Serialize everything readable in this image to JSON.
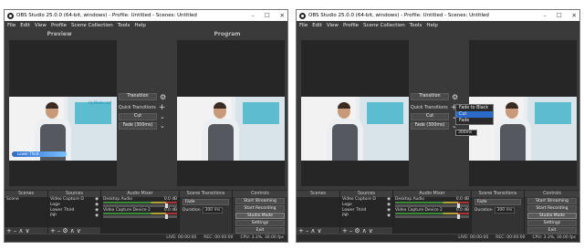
{
  "window_title": "OBS Studio 25.0.0 (64-bit, windows) - Profile: Untitled - Scenes: Untitled",
  "window_controls": [
    "–",
    "☐",
    "✕"
  ],
  "menu": [
    "File",
    "Edit",
    "View",
    "Profile",
    "Scene Collection",
    "Tools",
    "Help"
  ],
  "preview_label": "Preview",
  "program_label": "Program",
  "overlay": {
    "brand": "HyWebcast",
    "lower_third": "Lower Third"
  },
  "transitions_panel": {
    "transition_button": "Transition",
    "quick_transitions_label": "Quick Transitions",
    "cut": "Cut",
    "fade": "Fade (300ms)"
  },
  "dropdown_options": [
    "Fade to Black",
    "Cut",
    "Fade"
  ],
  "dropdown_selected": "Cut",
  "duration_spin": "300ms",
  "docks": {
    "scenes": {
      "title": "Scenes",
      "items": [
        "Scene"
      ]
    },
    "sources": {
      "title": "Sources",
      "items": [
        "Video Capture D",
        "Logo",
        "Lower Third",
        "PIP"
      ]
    },
    "audio_mixer": {
      "title": "Audio Mixer",
      "channels": [
        {
          "name": "Desktop Audio",
          "db": "0.0 dB"
        },
        {
          "name": "Video Capture Device 2",
          "db": "0.0 dB"
        }
      ]
    },
    "scene_transitions": {
      "title": "Scene Transitions",
      "selected": "Fade",
      "duration_label": "Duration",
      "duration_value": "300 ms"
    },
    "controls": {
      "title": "Controls",
      "buttons": [
        "Start Streaming",
        "Start Recording",
        "Studio Mode",
        "Settings",
        "Exit"
      ]
    }
  },
  "status_bar": {
    "live": "LIVE: 00:00:00",
    "rec": "REC: 00:00:00",
    "cpu": "CPU: 3.3%, 30.00 fps"
  },
  "status_bar_right": {
    "live": "LIVE: 00:00:00",
    "rec": "REC: 00:00:00",
    "cpu": "CPU: 3.3%, 30.00 fps"
  },
  "footer_icons": {
    "add": "+",
    "remove": "–",
    "up": "∧",
    "down": "∨"
  }
}
